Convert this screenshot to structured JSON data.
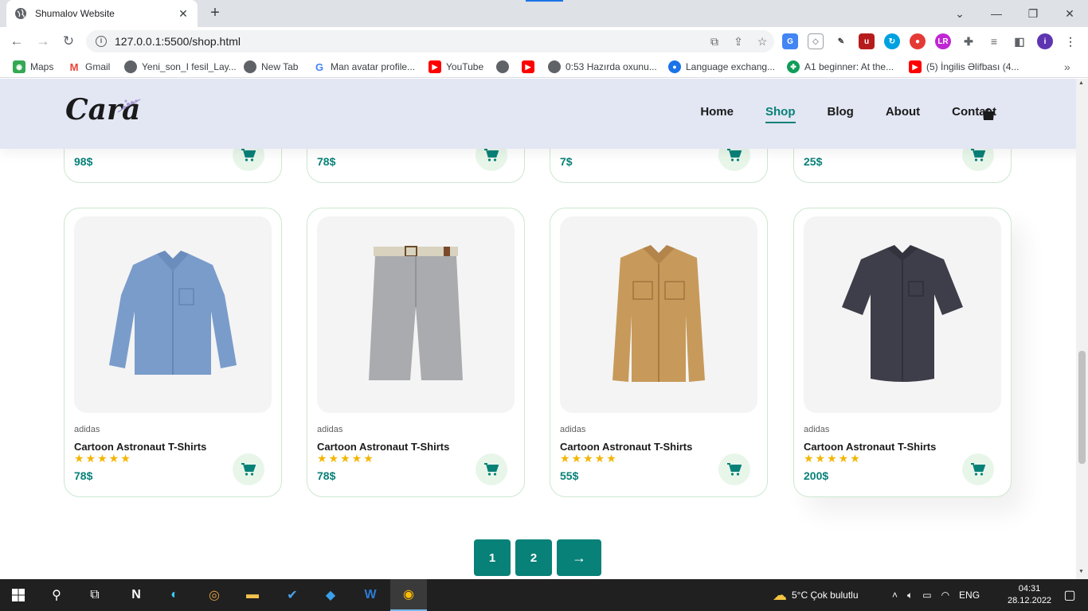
{
  "browser": {
    "tab_title": "Shumalov Website",
    "url": "127.0.0.1:5500/shop.html",
    "bookmarks": [
      {
        "label": "Maps",
        "icon": "maps-icon",
        "color": "#34a853"
      },
      {
        "label": "Gmail",
        "icon": "gmail-icon",
        "color": "#ea4335"
      },
      {
        "label": "Yeni_son_I fesil_Lay...",
        "icon": "globe-icon",
        "color": "#5f6368"
      },
      {
        "label": "New Tab",
        "icon": "globe-icon",
        "color": "#5f6368"
      },
      {
        "label": "Man avatar profile...",
        "icon": "google-icon",
        "color": "#4285f4"
      },
      {
        "label": "YouTube",
        "icon": "youtube-icon",
        "color": "#ff0000"
      },
      {
        "label": "",
        "icon": "globe-icon",
        "color": "#5f6368"
      },
      {
        "label": "",
        "icon": "youtube-icon",
        "color": "#ff0000"
      },
      {
        "label": "0:53 Hazırda oxunu...",
        "icon": "globe-icon",
        "color": "#5f6368"
      },
      {
        "label": "Language exchang...",
        "icon": "chat-icon",
        "color": "#1a73e8"
      },
      {
        "label": "A1 beginner: At the...",
        "icon": "clover-icon",
        "color": "#0f9d58"
      },
      {
        "label": "(5) İngilis Əlifbası (4...",
        "icon": "youtube-icon",
        "color": "#ff0000"
      }
    ]
  },
  "site": {
    "logo": "Cara",
    "nav": [
      {
        "label": "Home",
        "active": false
      },
      {
        "label": "Shop",
        "active": true
      },
      {
        "label": "Blog",
        "active": false
      },
      {
        "label": "About",
        "active": false
      },
      {
        "label": "Contact",
        "active": false
      }
    ],
    "accent": "#088178"
  },
  "top_row_prices": [
    "98$",
    "78$",
    "7$",
    "25$"
  ],
  "products": [
    {
      "brand": "adidas",
      "name": "Cartoon Astronaut T-Shirts",
      "stars": 5,
      "price": "78$",
      "image": "blue-long-sleeve-shirt"
    },
    {
      "brand": "adidas",
      "name": "Cartoon Astronaut T-Shirts",
      "stars": 5,
      "price": "78$",
      "image": "grey-shorts"
    },
    {
      "brand": "adidas",
      "name": "Cartoon Astronaut T-Shirts",
      "stars": 5,
      "price": "55$",
      "image": "tan-overshirt"
    },
    {
      "brand": "adidas",
      "name": "Cartoon Astronaut T-Shirts",
      "stars": 5,
      "price": "200$",
      "image": "navy-short-sleeve-shirt"
    }
  ],
  "pagination": {
    "pages": [
      "1",
      "2"
    ],
    "next": "→"
  },
  "taskbar": {
    "weather": "5°C  Çok bulutlu",
    "lang": "ENG",
    "time": "04:31",
    "date": "28.12.2022"
  }
}
